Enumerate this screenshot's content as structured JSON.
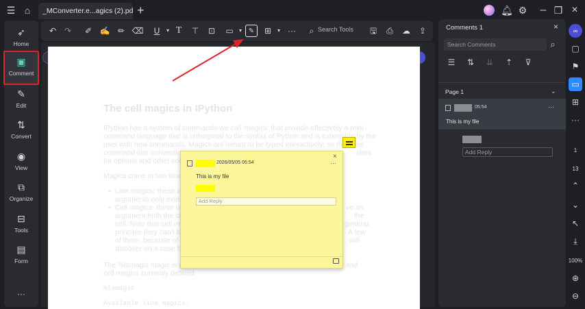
{
  "window": {
    "tab_title": "_MConverter.e...agics (2).pdf *",
    "tab_add": "+"
  },
  "left_nav": [
    {
      "id": "home",
      "label": "Home"
    },
    {
      "id": "comment",
      "label": "Comment",
      "active": true
    },
    {
      "id": "edit",
      "label": "Edit"
    },
    {
      "id": "convert",
      "label": "Convert"
    },
    {
      "id": "view",
      "label": "View"
    },
    {
      "id": "organize",
      "label": "Organize"
    },
    {
      "id": "tools",
      "label": "Tools"
    },
    {
      "id": "form",
      "label": "Form"
    }
  ],
  "left_nav_more": "···",
  "toolbar": {
    "search_label": "Search Tools"
  },
  "document": {
    "title": "The cell magics in IPython",
    "para1": [
      "IPython has a system of commands we call 'magics' that provide effectively a mini",
      "command language that is orthogonal to the syntax of Python and is extensible by the",
      "user with new commands. Magics are meant to be typed interactively, so they use",
      "command-line convention",
      "for options and other conv"
    ],
    "para1_tail": [
      "shes"
    ],
    "magics_intro": "Magics come in two kinds",
    "bullet1": [
      "Line magics: these are",
      "arguments only extend"
    ],
    "bullet2": [
      "Cell magics: these use",
      "argument both the cur",
      "cell. Note that cell ma",
      "principle they can't be",
      "of them, because of ho",
      "discover on a case by"
    ],
    "bullet2_tails": [
      "ve as",
      "the",
      "general",
      "A few",
      "will",
      ""
    ],
    "lsmagic_line1": "The %lsmagic magic is use",
    "lsmagic_line1_tail": "and",
    "lsmagic_line2": "cell magics currently defined:",
    "code1": "%lsmagic",
    "code2": "Available line magics:"
  },
  "popup": {
    "time": "2026/05/05 05:54",
    "body": "This is my file",
    "reply_placeholder": "Add Reply",
    "close": "×",
    "more": "···"
  },
  "comments_panel": {
    "title": "Comments 1",
    "search_placeholder": "Search Comments",
    "page_label": "Page 1",
    "comment_time": "05:54",
    "comment_text": "This is my file",
    "reply_placeholder": "Add Reply",
    "more": "···"
  },
  "right_rail": {
    "page_current": "1",
    "page_total": "13",
    "zoom": "100%"
  },
  "colors": {
    "accent": "#2e8bff",
    "highlight_box": "#e0222b",
    "sticky_note": "#fdf79b",
    "arrow": "#e0222b"
  }
}
